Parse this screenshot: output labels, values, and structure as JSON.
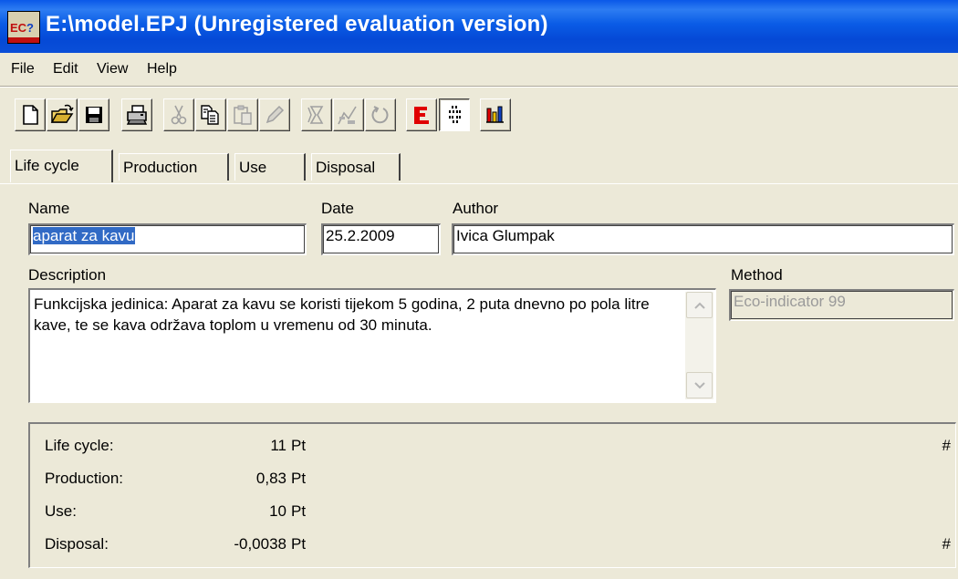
{
  "window": {
    "title": "E:\\model.EPJ (Unregistered evaluation version)",
    "app_icon": "eco-app-icon"
  },
  "menu": [
    "File",
    "Edit",
    "View",
    "Help"
  ],
  "toolbar": {
    "buttons": [
      {
        "icon": "new-document-icon",
        "enabled": true
      },
      {
        "icon": "open-folder-icon",
        "enabled": true
      },
      {
        "icon": "save-disk-icon",
        "enabled": true
      },
      {
        "icon": "print-icon",
        "enabled": true
      },
      {
        "icon": "cut-icon",
        "enabled": false
      },
      {
        "icon": "copy-icon",
        "enabled": true
      },
      {
        "icon": "paste-icon",
        "enabled": false
      },
      {
        "icon": "edit-pencil-icon",
        "enabled": false
      },
      {
        "icon": "hourglass-icon",
        "enabled": false
      },
      {
        "icon": "compare-icon",
        "enabled": false
      },
      {
        "icon": "refresh-icon",
        "enabled": false
      },
      {
        "icon": "eco-indicator-icon",
        "enabled": true
      },
      {
        "icon": "tree-view-icon",
        "enabled": true,
        "pressed": true
      },
      {
        "icon": "bar-chart-icon",
        "enabled": true
      }
    ]
  },
  "tabs": [
    {
      "label": "Life cycle",
      "active": true
    },
    {
      "label": "Production",
      "active": false
    },
    {
      "label": "Use",
      "active": false
    },
    {
      "label": "Disposal",
      "active": false
    }
  ],
  "form": {
    "name_label": "Name",
    "name_value": "aparat za kavu",
    "date_label": "Date",
    "date_value": "25.2.2009",
    "author_label": "Author",
    "author_value": "Ivica Glumpak",
    "description_label": "Description",
    "description_value": "Funkcijska jedinica: Aparat za kavu se koristi tijekom 5 godina, 2 puta dnevno po pola litre kave, te se kava održava toplom u vremenu od 30 minuta.",
    "method_label": "Method",
    "method_value": "Eco-indicator 99"
  },
  "results": [
    {
      "name": "Life cycle:",
      "value": "11",
      "unit": "Pt",
      "hash": "#"
    },
    {
      "name": "Production:",
      "value": "0,83",
      "unit": "Pt",
      "hash": ""
    },
    {
      "name": "Use:",
      "value": "10",
      "unit": "Pt",
      "hash": ""
    },
    {
      "name": "Disposal:",
      "value": "-0,0038",
      "unit": "Pt",
      "hash": "#"
    }
  ],
  "colors": {
    "titlebar": "#0a58e8",
    "window_bg": "#ece9d8",
    "selection": "#316ac5"
  }
}
